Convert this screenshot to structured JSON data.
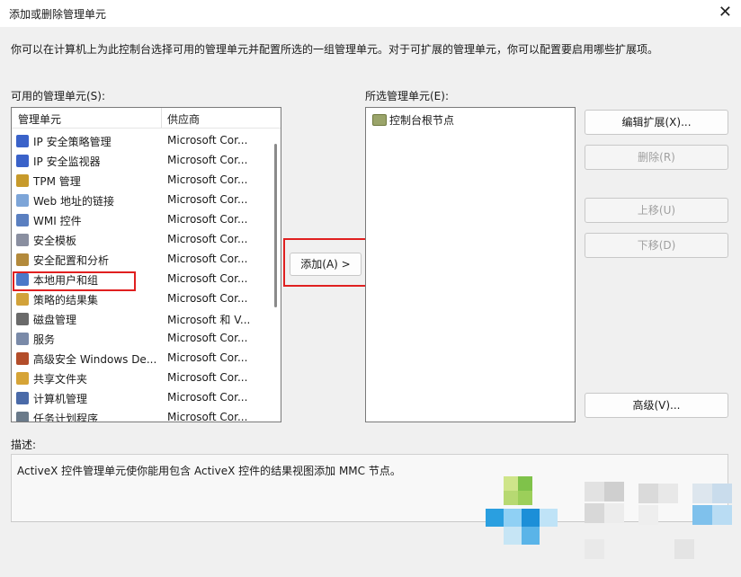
{
  "window": {
    "title": "添加或删除管理单元",
    "close_glyph": "✕"
  },
  "description_top": "你可以在计算机上为此控制台选择可用的管理单元并配置所选的一组管理单元。对于可扩展的管理单元，你可以配置要启用哪些扩展项。",
  "available": {
    "label": "可用的管理单元(S):",
    "col_name": "管理单元",
    "col_vendor": "供应商",
    "items": [
      {
        "name": "IP 安全策略管理",
        "vendor": "Microsoft Cor...",
        "icon": "ip-security-policy-icon",
        "color": "#3a62c9"
      },
      {
        "name": "IP 安全监视器",
        "vendor": "Microsoft Cor...",
        "icon": "ip-security-monitor-icon",
        "color": "#3a62c9"
      },
      {
        "name": "TPM 管理",
        "vendor": "Microsoft Cor...",
        "icon": "tpm-icon",
        "color": "#c79a2b"
      },
      {
        "name": "Web 地址的链接",
        "vendor": "Microsoft Cor...",
        "icon": "web-link-icon",
        "color": "#7da5d8"
      },
      {
        "name": "WMI 控件",
        "vendor": "Microsoft Cor...",
        "icon": "wmi-icon",
        "color": "#5a7fc0"
      },
      {
        "name": "安全模板",
        "vendor": "Microsoft Cor...",
        "icon": "security-template-icon",
        "color": "#8a8fa0"
      },
      {
        "name": "安全配置和分析",
        "vendor": "Microsoft Cor...",
        "icon": "security-config-icon",
        "color": "#b38a3c"
      },
      {
        "name": "本地用户和组",
        "vendor": "Microsoft Cor...",
        "icon": "local-users-icon",
        "color": "#4a78c8"
      },
      {
        "name": "策略的结果集",
        "vendor": "Microsoft Cor...",
        "icon": "rsop-icon",
        "color": "#d2a23a"
      },
      {
        "name": "磁盘管理",
        "vendor": "Microsoft 和 V...",
        "icon": "disk-management-icon",
        "color": "#6a6a6a"
      },
      {
        "name": "服务",
        "vendor": "Microsoft Cor...",
        "icon": "services-icon",
        "color": "#7a8aa8"
      },
      {
        "name": "高级安全 Windows De...",
        "vendor": "Microsoft Cor...",
        "icon": "firewall-icon",
        "color": "#b34d2a"
      },
      {
        "name": "共享文件夹",
        "vendor": "Microsoft Cor...",
        "icon": "shared-folders-icon",
        "color": "#d6a437"
      },
      {
        "name": "计算机管理",
        "vendor": "Microsoft Cor...",
        "icon": "computer-management-icon",
        "color": "#4a6aa8"
      },
      {
        "name": "任务计划程序",
        "vendor": "Microsoft Cor...",
        "icon": "task-scheduler-icon",
        "color": "#6a7a8a"
      }
    ]
  },
  "add_button": "添加(A) >",
  "selected": {
    "label": "所选管理单元(E):",
    "items": [
      {
        "name": "控制台根节点",
        "icon": "console-root-folder-icon"
      }
    ]
  },
  "side_buttons": {
    "edit_ext": "编辑扩展(X)...",
    "remove": "删除(R)",
    "move_up": "上移(U)",
    "move_down": "下移(D)",
    "advanced": "高级(V)..."
  },
  "description": {
    "label": "描述:",
    "text": "ActiveX 控件管理单元使你能用包含 ActiveX 控件的结果视图添加 MMC 节点。"
  }
}
